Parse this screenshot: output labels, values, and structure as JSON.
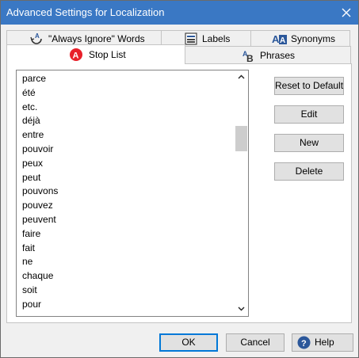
{
  "window": {
    "title": "Advanced Settings for Localization"
  },
  "tabs": {
    "always_ignore": "\"Always Ignore\" Words",
    "labels": "Labels",
    "synonyms": "Synonyms",
    "phrases": "Phrases",
    "stop_list": "Stop List"
  },
  "stop_list": {
    "items": [
      "parce",
      "été",
      "etc.",
      "déjà",
      "entre",
      "pouvoir",
      "peux",
      "peut",
      "pouvons",
      "pouvez",
      "peuvent",
      "faire",
      "fait",
      "ne",
      "chaque",
      "soit",
      "pour"
    ]
  },
  "side_buttons": {
    "reset": "Reset to Default",
    "edit": "Edit",
    "new": "New",
    "delete": "Delete"
  },
  "footer": {
    "ok": "OK",
    "cancel": "Cancel",
    "help": "Help"
  },
  "colors": {
    "titlebar": "#3a78c4",
    "stop_icon": "#e8202a",
    "default_button_border": "#0078d7",
    "help_icon": "#2b579a"
  }
}
